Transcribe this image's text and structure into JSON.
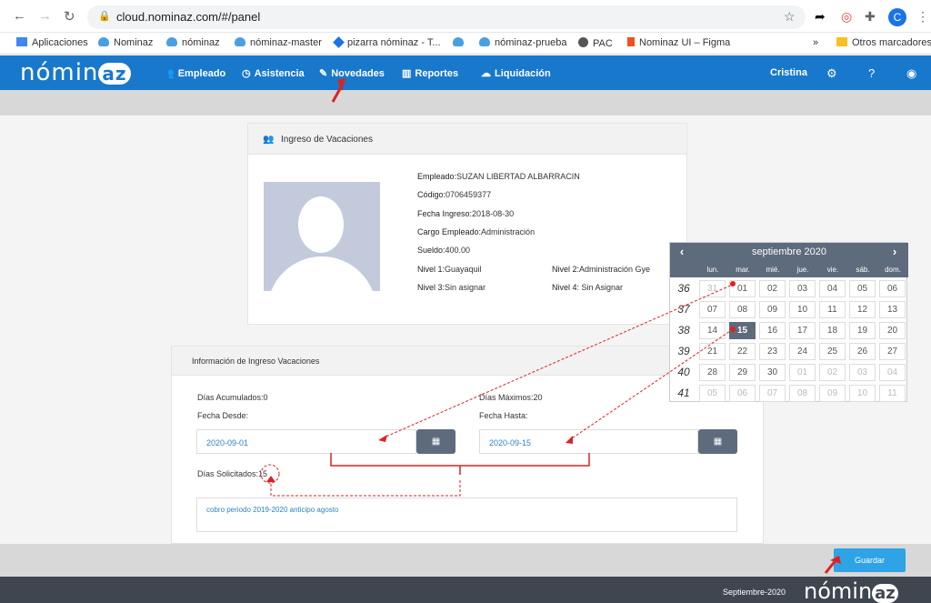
{
  "browser": {
    "url": "cloud.nominaz.com/#/panel",
    "profile_initial": "C",
    "bookmarks": [
      "Aplicaciones",
      "Nominaz",
      "nóminaz",
      "nóminaz-master",
      "pizarra nóminaz - T...",
      "nóminaz-prueba",
      "PAC",
      "Nominaz UI – Figma"
    ],
    "more_bookmarks": "»",
    "other_bookmarks": "Otros marcadores"
  },
  "navbar": {
    "logo": "nómin",
    "logo_az": "az",
    "items": [
      "Empleado",
      "Asistencia",
      "Novedades",
      "Reportes",
      "Liquidación"
    ],
    "user": "Cristina"
  },
  "employee": {
    "title": "Ingreso de Vacaciones",
    "empleado_label": "Empleado:",
    "empleado": "SUZAN LIBERTAD ALBARRACIN",
    "codigo_label": "Código:",
    "codigo": "0706459377",
    "fecha_ingreso_label": "Fecha Ingreso:",
    "fecha_ingreso": "2018-08-30",
    "cargo_label": "Cargo Empleado:",
    "cargo": "Administración",
    "sueldo_label": "Sueldo:",
    "sueldo": "400.00",
    "nivel1_label": "Nivel 1:",
    "nivel1": "Guayaquil",
    "nivel2_label": "Nivel 2:",
    "nivel2": "Administración Gye",
    "nivel3_label": "Nivel 3:",
    "nivel3": "Sin asignar",
    "nivel4_label": "Nivel 4:",
    "nivel4": " Sin Asignar"
  },
  "vacation": {
    "title": "Información de Ingreso Vacaciones",
    "acumulados_label": "Días Acumulados:",
    "acumulados": "0",
    "maximos_label": "Días Máximos:",
    "maximos": "20",
    "desde_label": "Fecha Desde:",
    "desde": "2020-09-01",
    "hasta_label": "Fecha Hasta:",
    "hasta": "2020-09-15",
    "solicitados_label": "Días Solicitados:",
    "solicitados": "15",
    "comment": "cobro periodo 2019-2020 anticipo agosto"
  },
  "calendar": {
    "title": "septiembre 2020",
    "prev": "‹",
    "next": "›",
    "weekdays": [
      "lun.",
      "mar.",
      "mié.",
      "jue.",
      "vie.",
      "sáb.",
      "dom."
    ],
    "weeks": [
      "36",
      "37",
      "38",
      "39",
      "40",
      "41"
    ],
    "days": [
      [
        "31",
        "01",
        "02",
        "03",
        "04",
        "05",
        "06"
      ],
      [
        "07",
        "08",
        "09",
        "10",
        "11",
        "12",
        "13"
      ],
      [
        "14",
        "15",
        "16",
        "17",
        "18",
        "19",
        "20"
      ],
      [
        "21",
        "22",
        "23",
        "24",
        "25",
        "26",
        "27"
      ],
      [
        "28",
        "29",
        "30",
        "01",
        "02",
        "03",
        "04"
      ],
      [
        "05",
        "06",
        "07",
        "08",
        "09",
        "10",
        "11"
      ]
    ],
    "selected": "15"
  },
  "actions": {
    "save": "Guardar"
  },
  "footer": {
    "date": "Septiembre-2020",
    "logo": "nómin",
    "logo_az": "az"
  },
  "colors": {
    "primary": "#1878cc",
    "annotation": "#e02020",
    "calendar": "#5d6b7d"
  }
}
